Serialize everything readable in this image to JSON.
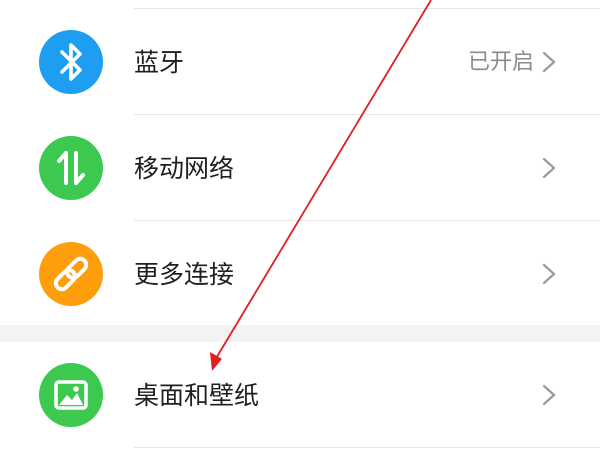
{
  "settings": {
    "items": [
      {
        "label": "蓝牙",
        "status": "已开启",
        "icon": "bluetooth-icon",
        "color": "#1e9ef0"
      },
      {
        "label": "移动网络",
        "status": "",
        "icon": "mobile-data-icon",
        "color": "#3dc94f"
      },
      {
        "label": "更多连接",
        "status": "",
        "icon": "link-icon",
        "color": "#ff9e0c"
      },
      {
        "label": "桌面和壁纸",
        "status": "",
        "icon": "image-icon",
        "color": "#3dc94f"
      }
    ]
  },
  "annotation": {
    "arrow_color": "#e0201f"
  }
}
